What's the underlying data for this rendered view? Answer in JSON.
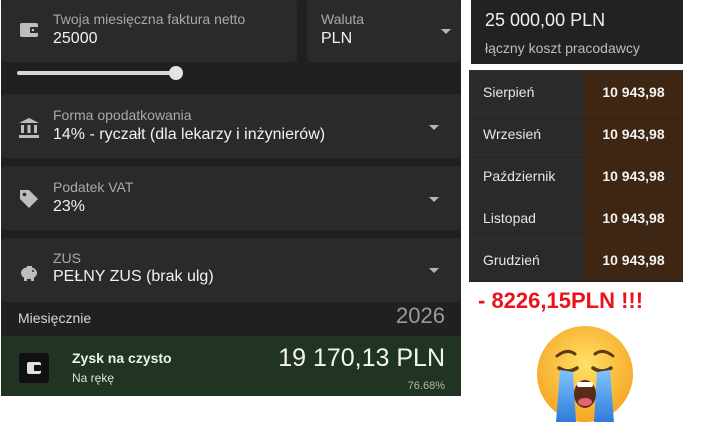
{
  "invoice": {
    "label": "Twoja miesięczna faktura netto",
    "value": "25000",
    "currency_label": "Waluta",
    "currency_value": "PLN",
    "slider_level": 0.37
  },
  "taxation": {
    "label": "Forma opodatkowania",
    "value": "14% - ryczałt (dla lekarzy i inżynierów)"
  },
  "vat": {
    "label": "Podatek VAT",
    "value": "23%"
  },
  "zus": {
    "label": "ZUS",
    "value": "PEŁNY ZUS (brak ulg)"
  },
  "summary": {
    "period_label": "Miesięcznie",
    "year": "2026",
    "net_title": "Zysk na czysto",
    "net_subtitle": "Na rękę",
    "net_amount": "19 170,13 PLN",
    "net_percent": "76.68%"
  },
  "employer_cost": {
    "amount": "25 000,00 PLN",
    "label": "łączny koszt pracodawcy"
  },
  "months": [
    {
      "name": "Sierpień",
      "value": "10 943,98"
    },
    {
      "name": "Wrzesień",
      "value": "10 943,98"
    },
    {
      "name": "Październik",
      "value": "10 943,98"
    },
    {
      "name": "Listopad",
      "value": "10 943,98"
    },
    {
      "name": "Grudzień",
      "value": "10 943,98"
    }
  ],
  "difference_text": "- 8226,15PLN !!!",
  "colors": {
    "panel_bg": "#202020",
    "net_bg": "#213423",
    "month_value_bg": "#3e2613",
    "difference": "#e8131b"
  }
}
